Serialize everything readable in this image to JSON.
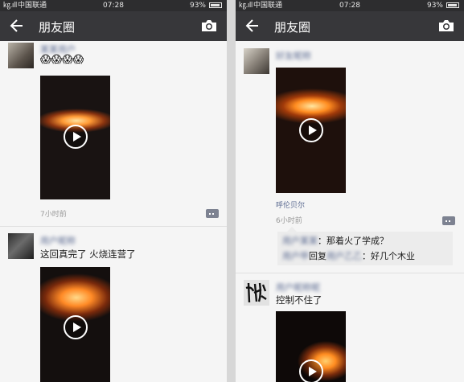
{
  "status": {
    "signal": "㎏.ıll",
    "carrier": "中国联通",
    "time": "07:28",
    "battery": "93%"
  },
  "left": {
    "nav_title": "朋友圈",
    "post1": {
      "name": "某某用户",
      "emoji": "😱😱😱😱",
      "time": "7小时前"
    },
    "post2": {
      "name": "用户昵称",
      "text": "这回真完了 火烧连营了"
    }
  },
  "right": {
    "nav_title": "朋友圈",
    "post1": {
      "name": "好友昵称",
      "location": "呼伦贝尔",
      "time": "6小时前",
      "comments": [
        {
          "user": "用户某某",
          "sep": "：",
          "text": "那着火了学成？"
        },
        {
          "user": "用户甲",
          "middle": "回复",
          "target": "用户乙乙",
          "sep": "：",
          "text": "好几个木业"
        }
      ]
    },
    "post2": {
      "name": "用户昵称昵",
      "text": "控制不住了"
    }
  }
}
